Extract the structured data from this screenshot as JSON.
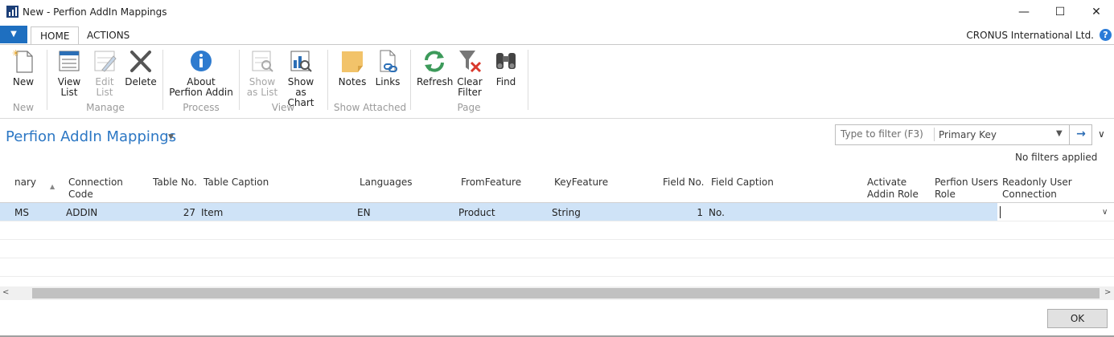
{
  "window": {
    "title": "New - Perfion AddIn Mappings",
    "controls": {
      "minimize": "—",
      "maximize": "☐",
      "close": "✕"
    }
  },
  "tabs": {
    "menu_glyph": "▼",
    "home": "HOME",
    "actions": "ACTIONS"
  },
  "company": "CRONUS International Ltd.",
  "help_glyph": "?",
  "ribbon": {
    "new": {
      "label": "New",
      "group": "New"
    },
    "manage": {
      "group": "Manage",
      "view_list": [
        "View",
        "List"
      ],
      "edit_list": [
        "Edit",
        "List"
      ],
      "delete": "Delete"
    },
    "process": {
      "group": "Process",
      "about": [
        "About",
        "Perfion Addin"
      ]
    },
    "view": {
      "group": "View",
      "show_as_list": [
        "Show",
        "as List"
      ],
      "show_as_chart": [
        "Show as",
        "Chart"
      ]
    },
    "show_attached": {
      "group": "Show Attached",
      "notes": "Notes",
      "links": "Links"
    },
    "page": {
      "group": "Page",
      "refresh": "Refresh",
      "clear_filter": [
        "Clear",
        "Filter"
      ],
      "find": "Find"
    }
  },
  "page": {
    "title": "Perfion AddIn Mappings",
    "title_caret": "▼",
    "filter": {
      "placeholder": "Type to filter (F3)",
      "field": "Primary Key",
      "dropdown_glyph": "▼",
      "go_glyph": "→"
    },
    "collapse_glyph": "∨",
    "no_filters": "No filters applied"
  },
  "grid": {
    "columns": [
      [
        "nary"
      ],
      [
        "Connection",
        "Code"
      ],
      [
        "Table No."
      ],
      [
        "Table Caption"
      ],
      [
        "Languages"
      ],
      [
        "FromFeature"
      ],
      [
        "KeyFeature"
      ],
      [
        "Field No."
      ],
      [
        "Field Caption"
      ],
      [
        "Activate",
        "Addin Role"
      ],
      [
        "Perfion Users",
        "Role"
      ],
      [
        "Readonly User",
        "Connection"
      ]
    ],
    "sort_glyph": "▲",
    "rows": [
      [
        "MS",
        "ADDIN",
        "27",
        "Item",
        "EN",
        "Product",
        "String",
        "1",
        "No.",
        "",
        "",
        ""
      ]
    ],
    "edit_dropdown_glyph": "∨"
  },
  "scrollbar": {
    "left_glyph": "<",
    "right_glyph": ">"
  },
  "ok_label": "OK",
  "colors": {
    "accent": "#2c77c4",
    "selection": "#cfe3f7",
    "menu": "#1e6fc0"
  }
}
